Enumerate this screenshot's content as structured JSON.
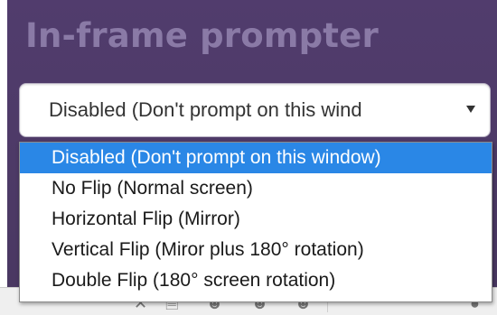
{
  "panel": {
    "title": "In-frame prompter"
  },
  "select": {
    "value": "Disabled (Don't prompt on this wind"
  },
  "dropdown": {
    "options": [
      {
        "label": "Disabled (Don't prompt on this window)",
        "selected": true
      },
      {
        "label": "No Flip (Normal screen)",
        "selected": false
      },
      {
        "label": "Horizontal Flip (Mirror)",
        "selected": false
      },
      {
        "label": "Vertical Flip (Miror plus 180° rotation)",
        "selected": false
      },
      {
        "label": "Double Flip (180° screen rotation)",
        "selected": false
      }
    ]
  },
  "toolbar": {
    "icons": [
      "close-icon",
      "document-icon",
      "person-icon",
      "person-icon",
      "person-icon",
      "info-icon"
    ]
  },
  "colors": {
    "panel_bg": "#4d3a66",
    "title_text": "#8a7aa6",
    "selected_bg": "#2a87e6"
  }
}
